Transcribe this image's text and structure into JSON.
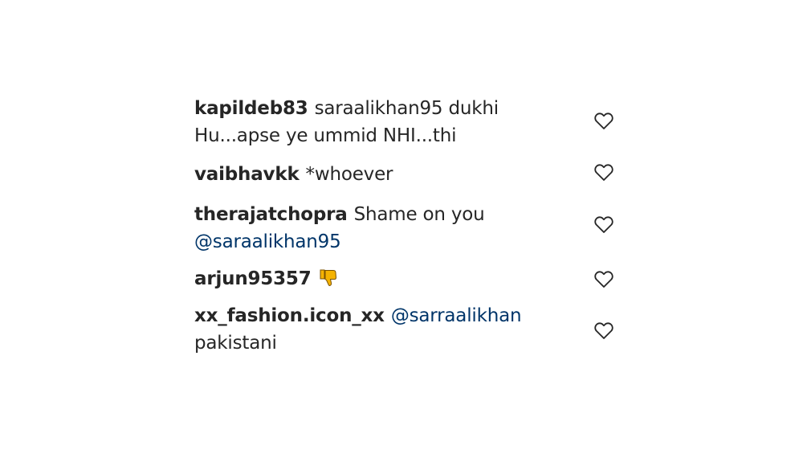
{
  "comments": [
    {
      "username": "kapildeb83",
      "text": "saraalikhan95 dukhi Hu...apse ye ummid NHI...thi",
      "mention": "",
      "trailing_text": ""
    },
    {
      "username": "vaibhavkk",
      "text": "*whoever",
      "mention": "",
      "trailing_text": ""
    },
    {
      "username": "therajatchopra",
      "text": "Shame on you",
      "mention": "@saraalikhan95",
      "trailing_text": ""
    },
    {
      "username": "arjun95357",
      "text": "",
      "mention": "",
      "trailing_text": "",
      "emoji": "thumbs-down-emoji"
    },
    {
      "username": "xx_fashion.icon_xx",
      "text": "",
      "mention": "@sarraalikhan",
      "trailing_text": "pakistani"
    }
  ],
  "icons": {
    "like": "heart-icon"
  },
  "colors": {
    "username": "#262626",
    "text": "#262626",
    "mention": "#003569",
    "heart_stroke": "#262626",
    "thumb_fill": "#f5b301"
  }
}
